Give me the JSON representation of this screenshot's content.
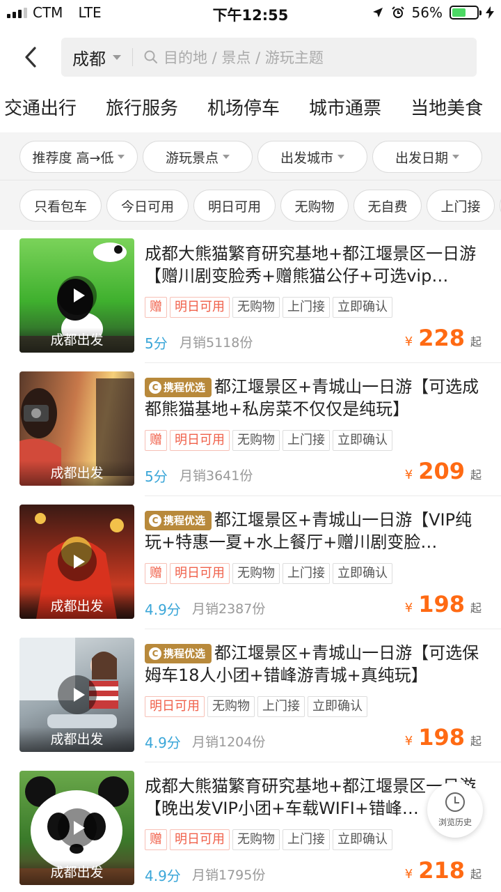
{
  "status_bar": {
    "carrier": "CTM",
    "network": "LTE",
    "time": "下午12:55",
    "battery_percent": "56%",
    "battery_level": 0.56
  },
  "header": {
    "back_icon": "chevron-left-icon",
    "city": "成都",
    "search_placeholder": "目的地 / 景点 / 游玩主题"
  },
  "categories": [
    "交通出行",
    "旅行服务",
    "机场停车",
    "城市通票",
    "当地美食"
  ],
  "filters": {
    "sort": "推荐度 高→低",
    "scenic": "游玩景点",
    "depart_city": "出发城市",
    "depart_date": "出发日期"
  },
  "quick_tags": [
    "只看包车",
    "今日可用",
    "明日可用",
    "无购物",
    "无自费",
    "上门接"
  ],
  "products": [
    {
      "title": "成都大熊猫繁育研究基地+都江堰景区一日游【赠川剧变脸秀+赠熊猫公仔+可选vip…",
      "badge": "",
      "thumb_label": "成都出发",
      "tags": [
        "赠",
        "明日可用",
        "无购物",
        "上门接",
        "立即确认"
      ],
      "score": "5分",
      "sales": "月销5118份",
      "currency": "¥",
      "price": "228",
      "price_suffix": "起"
    },
    {
      "title": "都江堰景区+青城山一日游【可选成都熊猫基地+私房菜不仅仅是纯玩】",
      "badge": "携程优选",
      "thumb_label": "成都出发",
      "tags": [
        "赠",
        "明日可用",
        "无购物",
        "上门接",
        "立即确认"
      ],
      "score": "5分",
      "sales": "月销3641份",
      "currency": "¥",
      "price": "209",
      "price_suffix": "起"
    },
    {
      "title": "都江堰景区+青城山一日游【VIP纯玩+特惠一夏+水上餐厅+赠川剧变脸…",
      "badge": "携程优选",
      "thumb_label": "成都出发",
      "tags": [
        "赠",
        "明日可用",
        "无购物",
        "上门接",
        "立即确认"
      ],
      "score": "4.9分",
      "sales": "月销2387份",
      "currency": "¥",
      "price": "198",
      "price_suffix": "起"
    },
    {
      "title": "都江堰景区+青城山一日游【可选保姆车18人小团+错峰游青城+真纯玩】",
      "badge": "携程优选",
      "thumb_label": "成都出发",
      "tags": [
        "明日可用",
        "无购物",
        "上门接",
        "立即确认"
      ],
      "score": "4.9分",
      "sales": "月销1204份",
      "currency": "¥",
      "price": "198",
      "price_suffix": "起"
    },
    {
      "title": "成都大熊猫繁育研究基地+都江堰景区一日游【晚出发VIP小团+车载WIFI+错峰…",
      "badge": "",
      "thumb_label": "成都出发",
      "tags": [
        "赠",
        "明日可用",
        "无购物",
        "上门接",
        "立即确认"
      ],
      "score": "4.9分",
      "sales": "月销1795份",
      "currency": "¥",
      "price": "218",
      "price_suffix": "起"
    }
  ],
  "floating": {
    "history_label": "浏览历史",
    "history_icon": "clock-icon"
  },
  "colors": {
    "price": "#ff6a13",
    "score": "#3aa6d8",
    "badge": "#b8893b",
    "tag_red": "#f0604a"
  }
}
